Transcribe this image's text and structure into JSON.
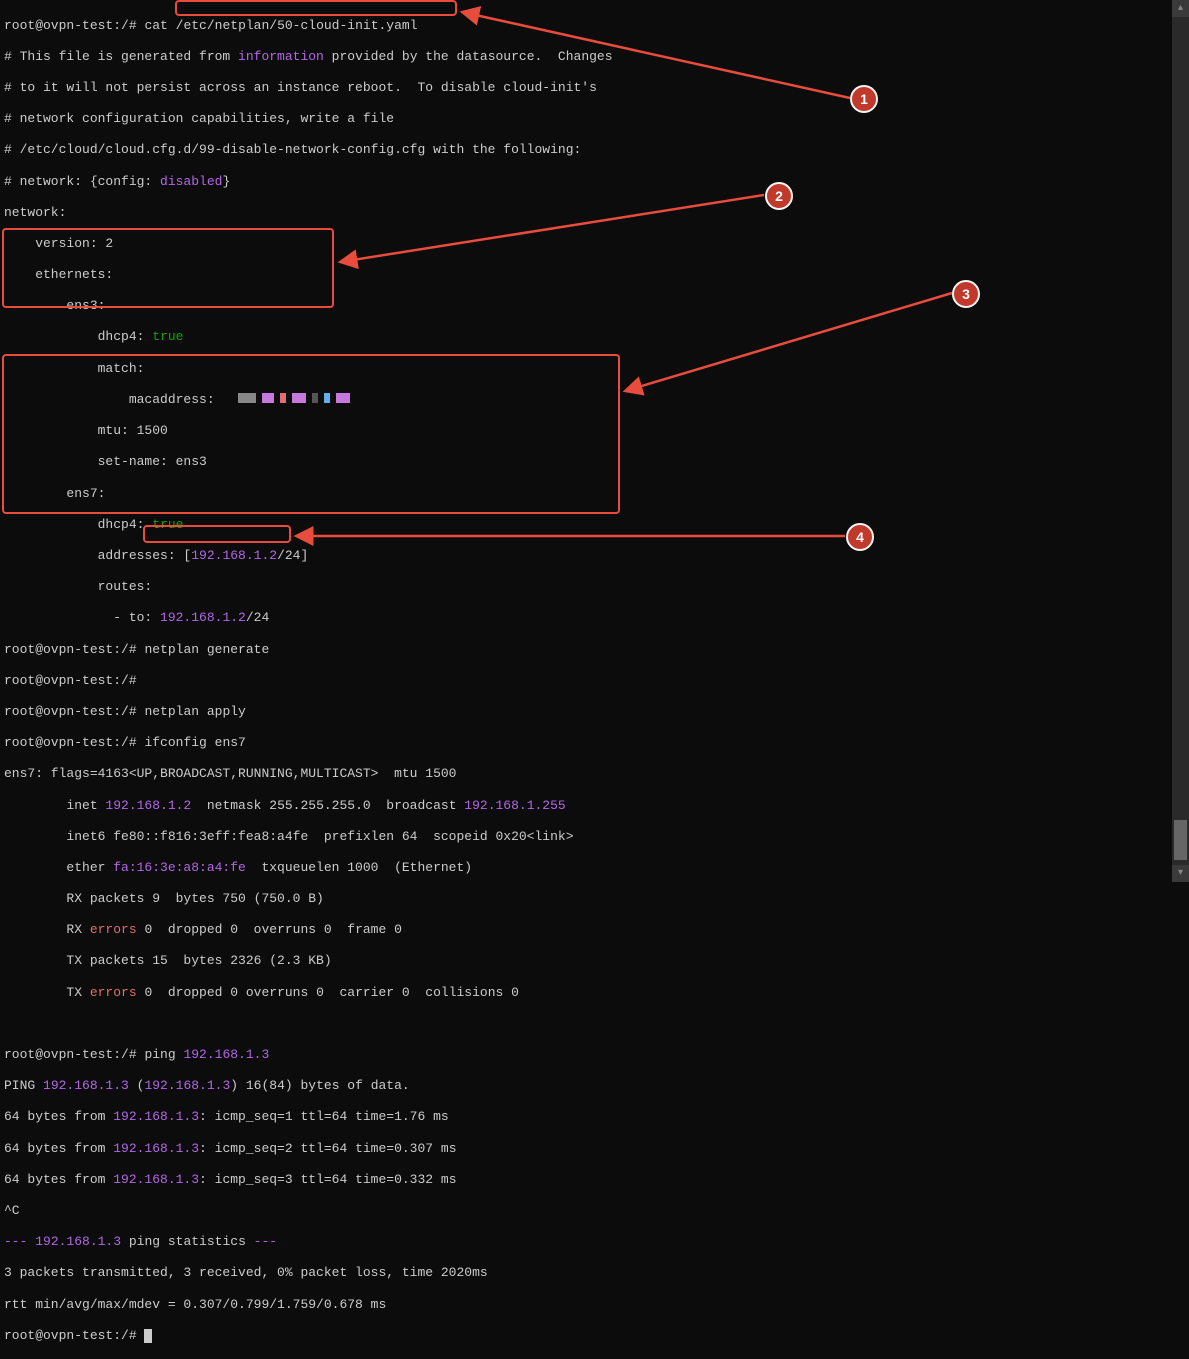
{
  "prompt": "root@ovpn-test:/#",
  "cmd_cat": "cat",
  "file_path": "/etc/netplan/50-cloud-init.yaml",
  "yaml": {
    "l1": "# This file is generated from ",
    "l1b": "information",
    "l1c": " provided by the datasource.  Changes",
    "l2": "# to it will not persist across an instance reboot.  To disable cloud-init's",
    "l3": "# network configuration capabilities, write a file",
    "l4": "# /etc/cloud/cloud.cfg.d/99-disable-network-config.cfg with the following:",
    "l5a": "# network: {config: ",
    "l5b": "disabled",
    "l5c": "}",
    "l6": "network:",
    "l7": "    version: 2",
    "l8": "    ethernets:",
    "l9": "        ens3:",
    "l10a": "            dhcp4: ",
    "l10b": "true",
    "l11": "            match:",
    "l12": "                macaddress:",
    "l13": "            mtu: 1500",
    "l14": "            set-name: ens3",
    "l15": "        ens7:",
    "l16a": "            dhcp4: ",
    "l16b": "true",
    "l17a": "            addresses: [",
    "l17b": "192.168.1.2",
    "l17c": "/24]",
    "l18": "            routes:",
    "l19a": "              - to: ",
    "l19b": "192.168.1.2",
    "l19c": "/24"
  },
  "cmd_gen": "netplan generate",
  "cmd_apply": "netplan apply",
  "cmd_ifconfig": "ifconfig ens7",
  "ifconfig": {
    "l1": "ens7: flags=4163<UP,BROADCAST,RUNNING,MULTICAST>  mtu 1500",
    "l2a": "        inet ",
    "l2b": "192.168.1.2",
    "l2c": "  netmask 255.255.255.0  broadcast ",
    "l2d": "192.168.1.255",
    "l3": "        inet6 fe80::f816:3eff:fea8:a4fe  prefixlen 64  scopeid 0x20<link>",
    "l4a": "        ether ",
    "l4b": "fa:16:3e:a8:a4:fe",
    "l4c": "  txqueuelen 1000  (Ethernet)",
    "l5": "        RX packets 9  bytes 750 (750.0 B)",
    "l6a": "        RX ",
    "l6b": "errors",
    "l6c": " 0  dropped 0  overruns 0  frame 0",
    "l7": "        TX packets 15  bytes 2326 (2.3 KB)",
    "l8a": "        TX ",
    "l8b": "errors",
    "l8c": " 0  dropped 0 overruns 0  carrier 0  collisions 0"
  },
  "cmd_ping_a": "ping ",
  "cmd_ping_b": "192.168.1.3",
  "ping": {
    "l1a": "PING ",
    "l1b": "192.168.1.3",
    "l1c": " (",
    "l1d": "192.168.1.3",
    "l1e": ") 16(84) bytes of data.",
    "l2a": "64 bytes from ",
    "l2b": "192.168.1.3",
    "l2c": ": icmp_seq=1 ttl=64 time=1.76 ms",
    "l3a": "64 bytes from ",
    "l3b": "192.168.1.3",
    "l3c": ": icmp_seq=2 ttl=64 time=0.307 ms",
    "l4a": "64 bytes from ",
    "l4b": "192.168.1.3",
    "l4c": ": icmp_seq=3 ttl=64 time=0.332 ms",
    "l5": "^C",
    "l6a": "--- ",
    "l6b": "192.168.1.3",
    "l6c": " ping statistics ",
    "l6d": "---",
    "l7": "3 packets transmitted, 3 received, 0% packet loss, time 2020ms",
    "l8": "rtt min/avg/max/mdev = 0.307/0.799/1.759/0.678 ms"
  },
  "callouts": {
    "1": "1",
    "2": "2",
    "3": "3",
    "4": "4"
  }
}
